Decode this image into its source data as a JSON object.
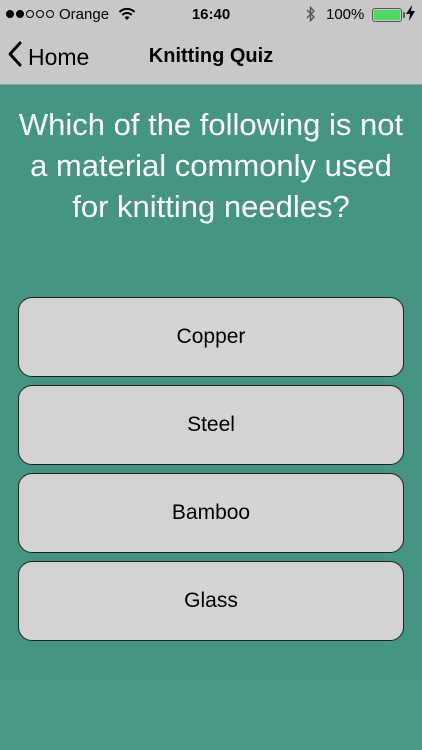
{
  "status_bar": {
    "carrier": "Orange",
    "time": "16:40",
    "battery_percent": "100%",
    "signal_bars_filled": 2,
    "signal_bars_total": 5
  },
  "nav": {
    "back_label": "Home",
    "title": "Knitting Quiz"
  },
  "question": "Which of the following is not a material commonly used for knitting needles?",
  "answers": [
    "Copper",
    "Steel",
    "Bamboo",
    "Glass"
  ],
  "colors": {
    "background": "#459584",
    "bar": "#c8c8c8",
    "answer_bg": "#d3d3d3",
    "battery": "#4cd964"
  }
}
